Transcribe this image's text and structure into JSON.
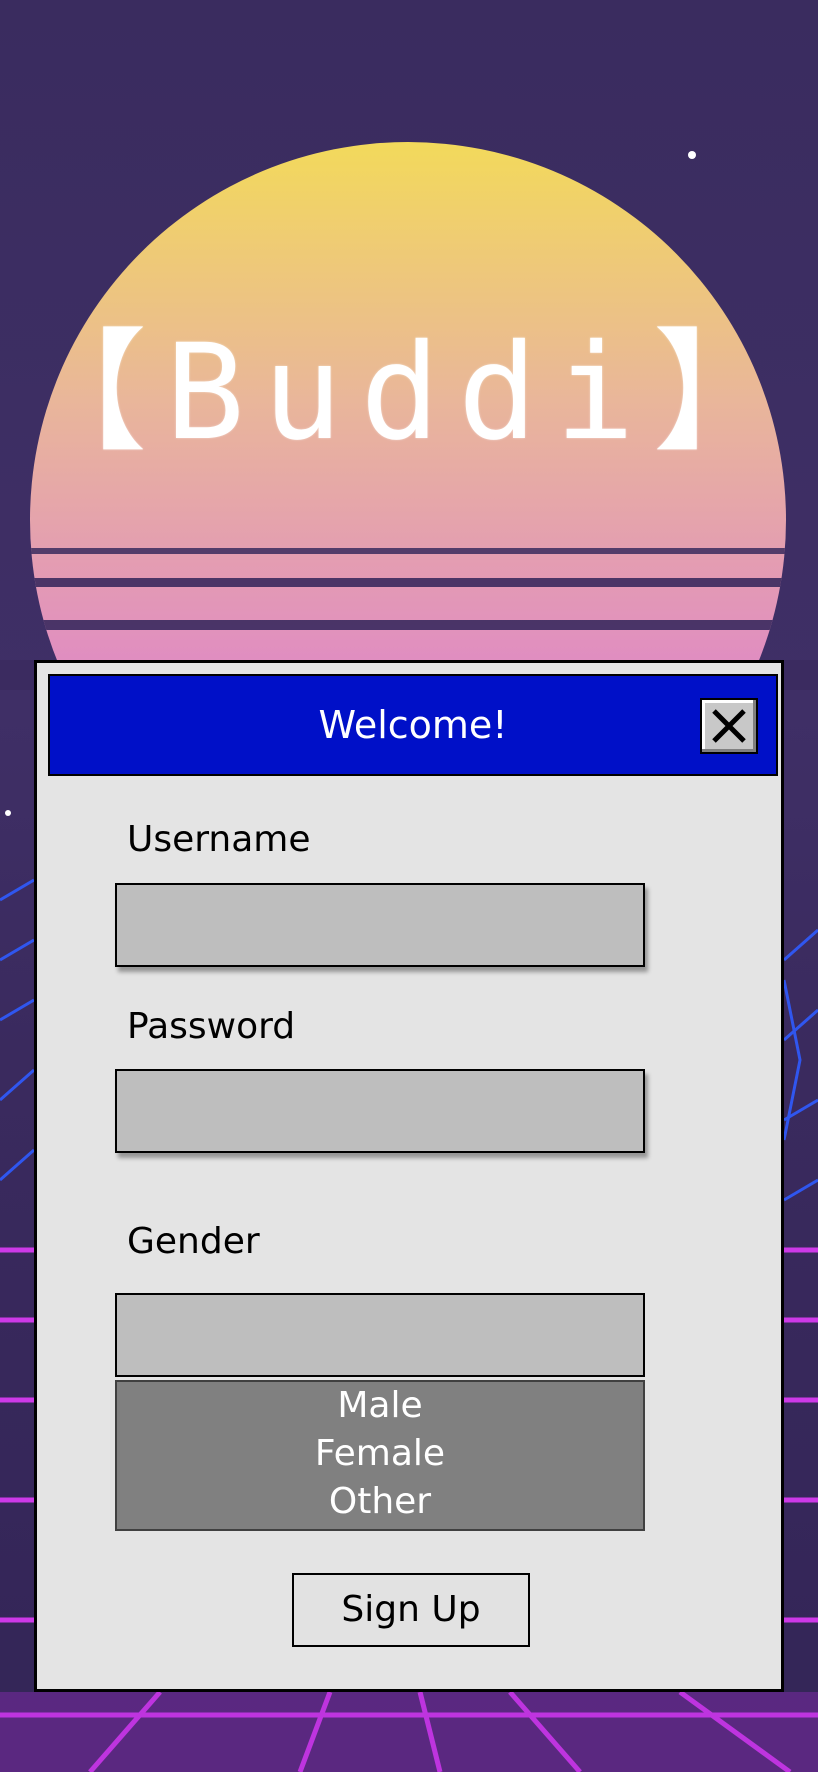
{
  "app": {
    "logo_text": "【Buddi】"
  },
  "dialog": {
    "title": "Welcome!",
    "close_icon": "close-icon",
    "username": {
      "label": "Username",
      "value": "",
      "placeholder": ""
    },
    "password": {
      "label": "Password",
      "value": "",
      "placeholder": ""
    },
    "gender": {
      "label": "Gender",
      "value": "",
      "options": [
        "Male",
        "Female",
        "Other"
      ]
    },
    "signup_label": "Sign Up"
  },
  "colors": {
    "titlebar": "#0010c8",
    "window": "#e4e4e4",
    "field": "#bebebe",
    "dropdown": "#808080",
    "sun_top": "#f3d95a",
    "sun_bottom": "#e28fc0",
    "grid_magenta": "#d63af0",
    "grid_blue": "#2b4dff"
  }
}
